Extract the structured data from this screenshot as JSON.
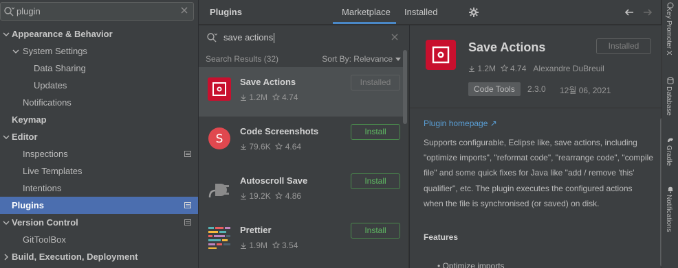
{
  "sidebar": {
    "search_value": "plugin",
    "items": [
      {
        "label": "Appearance & Behavior"
      },
      {
        "label": "System Settings"
      },
      {
        "label": "Data Sharing"
      },
      {
        "label": "Updates"
      },
      {
        "label": "Notifications"
      },
      {
        "label": "Keymap"
      },
      {
        "label": "Editor"
      },
      {
        "label": "Inspections"
      },
      {
        "label": "Live Templates"
      },
      {
        "label": "Intentions"
      },
      {
        "label": "Plugins"
      },
      {
        "label": "Version Control"
      },
      {
        "label": "GitToolBox"
      },
      {
        "label": "Build, Execution, Deployment"
      }
    ]
  },
  "header": {
    "title": "Plugins",
    "tabs": [
      {
        "label": "Marketplace",
        "active": true
      },
      {
        "label": "Installed",
        "active": false
      }
    ]
  },
  "results": {
    "search_value": "save actions",
    "count_label": "Search Results (32)",
    "sort_label": "Sort By: Relevance",
    "items": [
      {
        "name": "Save Actions",
        "downloads": "1.2M",
        "rating": "4.74",
        "button": "Installed",
        "icon": "save-actions-icon",
        "selected": true
      },
      {
        "name": "Code Screenshots",
        "downloads": "79.6K",
        "rating": "4.64",
        "button": "Install",
        "icon": "code-screenshots-icon",
        "initial": "S"
      },
      {
        "name": "Autoscroll Save",
        "downloads": "19.2K",
        "rating": "4.86",
        "button": "Install",
        "icon": "plug-icon"
      },
      {
        "name": "Prettier",
        "downloads": "1.9M",
        "rating": "3.54",
        "button": "Install",
        "icon": "prettier-icon"
      }
    ]
  },
  "detail": {
    "name": "Save Actions",
    "downloads": "1.2M",
    "rating": "4.74",
    "vendor": "Alexandre DuBreuil",
    "button": "Installed",
    "tag": "Code Tools",
    "version": "2.3.0",
    "date": "12월 06, 2021",
    "homepage": "Plugin homepage ↗",
    "description": "Supports configurable, Eclipse like, save actions, including \"optimize imports\", \"reformat code\", \"rearrange code\", \"compile file\" and some quick fixes for Java like \"add / remove 'this' qualifier\", etc. The plugin executes the configured actions when the file is synchronised (or saved) on disk.",
    "features_heading": "Features",
    "first_feature": "• Optimize imports"
  },
  "right_strip": {
    "labels": [
      "Key Promoter X",
      "Database",
      "Gradle",
      "Notifications"
    ]
  },
  "colors": {
    "selection": "#4b6eaf",
    "accent_blue": "#4a88c7",
    "install_green": "#5fb862",
    "save_actions_red": "#c8102e",
    "link": "#5a9fd6"
  }
}
